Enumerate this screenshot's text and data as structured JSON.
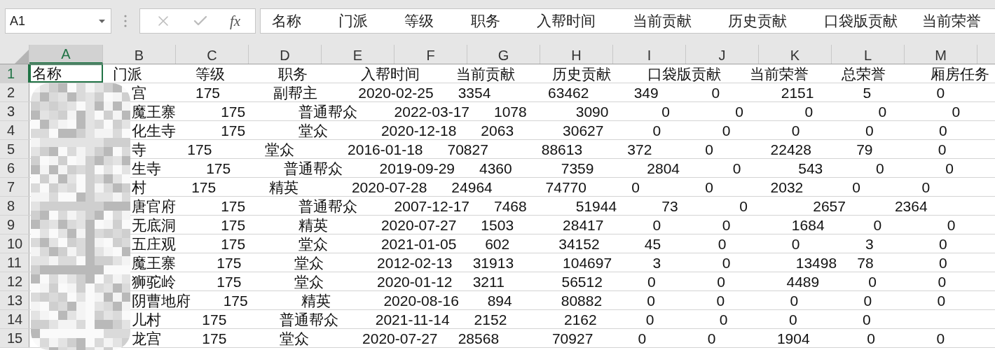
{
  "name_box": {
    "value": "A1"
  },
  "formula_bar": {
    "cancel_icon_disabled": true,
    "enter_icon_disabled": true,
    "function_button": "fx",
    "value": "名称         门派         等级         职务         入帮时间         当前贡献         历史贡献         口袋版贡献      当前荣誉"
  },
  "columns": [
    {
      "label": "A",
      "selected": true
    },
    {
      "label": "B",
      "selected": false
    },
    {
      "label": "C",
      "selected": false
    },
    {
      "label": "D",
      "selected": false
    },
    {
      "label": "E",
      "selected": false
    },
    {
      "label": "F",
      "selected": false
    },
    {
      "label": "G",
      "selected": false
    },
    {
      "label": "H",
      "selected": false
    },
    {
      "label": "I",
      "selected": false
    },
    {
      "label": "J",
      "selected": false
    },
    {
      "label": "K",
      "selected": false
    },
    {
      "label": "L",
      "selected": false
    },
    {
      "label": "M",
      "selected": false
    }
  ],
  "header_row": {
    "number": "1",
    "selected": true,
    "cell_text": "名称",
    "text": "门派             等级             职务             入帮时间         当前贡献         历史贡献         口袋版贡献       当前荣誉        总荣誉           厢房任务"
  },
  "rows": [
    {
      "number": "2",
      "selected": false,
      "text": "宫            175             副帮主          2020-02-25      3354              63462           349             0               2151            5                0"
    },
    {
      "number": "3",
      "selected": false,
      "text": "魔王寨           175             普通帮众         2022-03-17      1078            3090             0                0               0                0                0"
    },
    {
      "number": "4",
      "selected": false,
      "text": "化生寺           175             堂众             2020-12-18      2063            30627            0               0               0                0                0"
    },
    {
      "number": "5",
      "selected": false,
      "text": "寺          175             堂众             2016-01-18      70827             88613           372             0              22428           79                0"
    },
    {
      "number": "6",
      "selected": false,
      "text": "生寺           175             普通帮众         2019-09-29      4360            7359             2804             0              543             0               0"
    },
    {
      "number": "7",
      "selected": false,
      "text": "村           175             精英             2020-07-28      24964             74770           0                0              2032            0               0"
    },
    {
      "number": "8",
      "selected": false,
      "text": "唐官府           175             普通帮众         2007-12-17      7468            51944           73               0                2657            2364"
    },
    {
      "number": "9",
      "selected": false,
      "text": "无底洞           175             精英             2020-07-27      1503            28417            0               0               1684            0                0"
    },
    {
      "number": "10",
      "selected": false,
      "text": "五庄观           175             堂众             2021-01-05       602            34152           45              0                0                3                0"
    },
    {
      "number": "11",
      "selected": false,
      "text": "魔王寨          175             堂众             2012-02-13     31913            104697          3               0                13498     78                0"
    },
    {
      "number": "12",
      "selected": false,
      "text": "狮驼岭          175             堂众             2020-01-12     3211              56512           0               0               4489            0               0"
    },
    {
      "number": "13",
      "selected": false,
      "text": "阴曹地府        175             精英             2020-08-16       894            80882           0               0                0                0                0"
    },
    {
      "number": "14",
      "selected": false,
      "text": "儿村          175             普通帮众         2021-11-14      2152              2162            0                0               0                0"
    },
    {
      "number": "15",
      "selected": false,
      "text": "龙宫          175             堂众             2020-07-27     28568             70927           0               0               1904              0               0"
    }
  ]
}
